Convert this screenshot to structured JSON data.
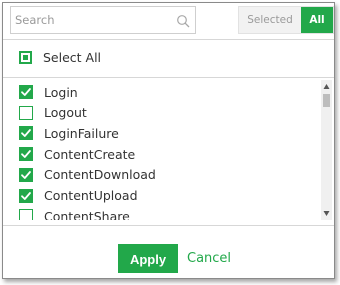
{
  "search": {
    "placeholder": "Search",
    "value": ""
  },
  "filter_toggle": {
    "selected_label": "Selected",
    "all_label": "All",
    "active": "All"
  },
  "select_all": {
    "label": "Select All",
    "state": "indeterminate"
  },
  "items": [
    {
      "label": "Login",
      "checked": true
    },
    {
      "label": "Logout",
      "checked": false
    },
    {
      "label": "LoginFailure",
      "checked": true
    },
    {
      "label": "ContentCreate",
      "checked": true
    },
    {
      "label": "ContentDownload",
      "checked": true
    },
    {
      "label": "ContentUpload",
      "checked": true
    },
    {
      "label": "ContentShare",
      "checked": false
    }
  ],
  "footer": {
    "apply_label": "Apply",
    "cancel_label": "Cancel"
  },
  "colors": {
    "accent": "#22a84a",
    "border": "#cfcfcf"
  }
}
